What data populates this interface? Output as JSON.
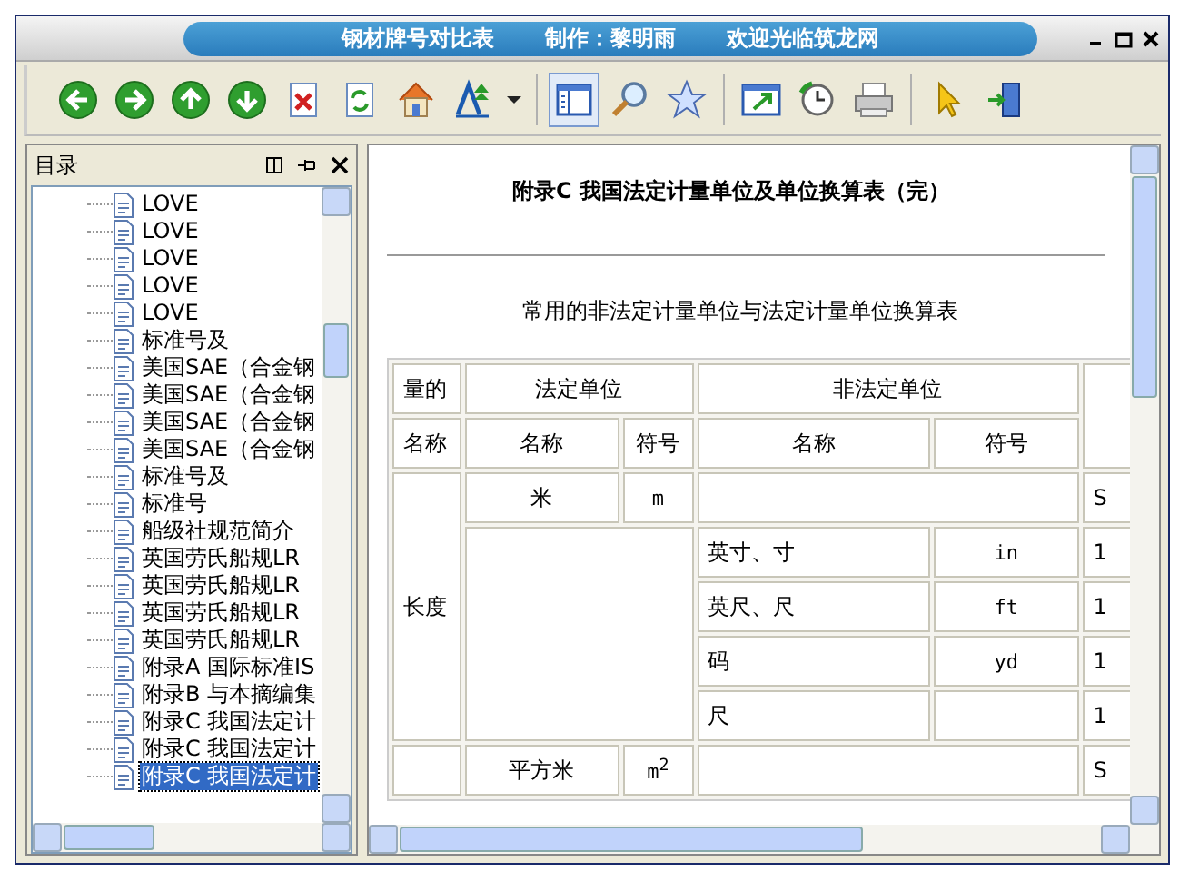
{
  "window": {
    "title_parts": [
      "钢材牌号对比表",
      "制作：黎明雨",
      "欢迎光临筑龙网"
    ]
  },
  "toolbar": [
    {
      "kind": "back",
      "pressed": false
    },
    {
      "kind": "forward",
      "pressed": false
    },
    {
      "kind": "up",
      "pressed": false
    },
    {
      "kind": "down",
      "pressed": false
    },
    {
      "kind": "close-doc",
      "pressed": false
    },
    {
      "kind": "refresh",
      "pressed": false
    },
    {
      "kind": "home",
      "pressed": false
    },
    {
      "kind": "font",
      "pressed": false
    },
    {
      "kind": "caret",
      "pressed": false
    },
    {
      "kind": "sep"
    },
    {
      "kind": "panel",
      "pressed": true
    },
    {
      "kind": "search",
      "pressed": false
    },
    {
      "kind": "star",
      "pressed": false
    },
    {
      "kind": "sep"
    },
    {
      "kind": "resize",
      "pressed": false
    },
    {
      "kind": "history",
      "pressed": false
    },
    {
      "kind": "print",
      "pressed": false
    },
    {
      "kind": "sep"
    },
    {
      "kind": "pointer",
      "pressed": false
    },
    {
      "kind": "exit",
      "pressed": false
    }
  ],
  "sidebar": {
    "title": "目录",
    "items": [
      {
        "label": "LOVE",
        "selected": false
      },
      {
        "label": "LOVE",
        "selected": false
      },
      {
        "label": "LOVE",
        "selected": false
      },
      {
        "label": "LOVE",
        "selected": false
      },
      {
        "label": "LOVE",
        "selected": false
      },
      {
        "label": "标准号及",
        "selected": false
      },
      {
        "label": "美国SAE（合金钢",
        "selected": false
      },
      {
        "label": "美国SAE（合金钢",
        "selected": false
      },
      {
        "label": "美国SAE（合金钢",
        "selected": false
      },
      {
        "label": "美国SAE（合金钢",
        "selected": false
      },
      {
        "label": "标准号及",
        "selected": false
      },
      {
        "label": "标准号",
        "selected": false
      },
      {
        "label": "船级社规范简介",
        "selected": false
      },
      {
        "label": "英国劳氏船规LR",
        "selected": false
      },
      {
        "label": "英国劳氏船规LR",
        "selected": false
      },
      {
        "label": "英国劳氏船规LR",
        "selected": false
      },
      {
        "label": "英国劳氏船规LR",
        "selected": false
      },
      {
        "label": "附录A 国际标准IS",
        "selected": false
      },
      {
        "label": "附录B 与本摘编集",
        "selected": false
      },
      {
        "label": "附录C 我国法定计",
        "selected": false
      },
      {
        "label": "附录C 我国法定计",
        "selected": false
      },
      {
        "label": "附录C 我国法定计",
        "selected": true
      }
    ]
  },
  "document": {
    "title": "附录C 我国法定计量单位及单位换算表（完）",
    "subtitle": "常用的非法定计量单位与法定计量单位换算表",
    "table": {
      "header_top": [
        "量的",
        "法定单位",
        "非法定单位"
      ],
      "header_bottom": [
        "名称",
        "名称",
        "符号",
        "名称",
        "符号"
      ],
      "groups": [
        {
          "quantity": "长度",
          "legal": [
            {
              "name": "米",
              "symbol": "m",
              "column_6": "S"
            }
          ],
          "non_legal": [
            {
              "name": "英寸、寸",
              "symbol": "in",
              "column_6": "1"
            },
            {
              "name": "英尺、尺",
              "symbol": "ft",
              "column_6": "1"
            },
            {
              "name": "码",
              "symbol": "yd",
              "column_6": "1"
            },
            {
              "name": "尺",
              "column_6": "1"
            }
          ]
        },
        {
          "legal": [
            {
              "name": "平方米",
              "symbol": "m$^{2}$",
              "column_6": "S"
            }
          ]
        }
      ]
    }
  }
}
